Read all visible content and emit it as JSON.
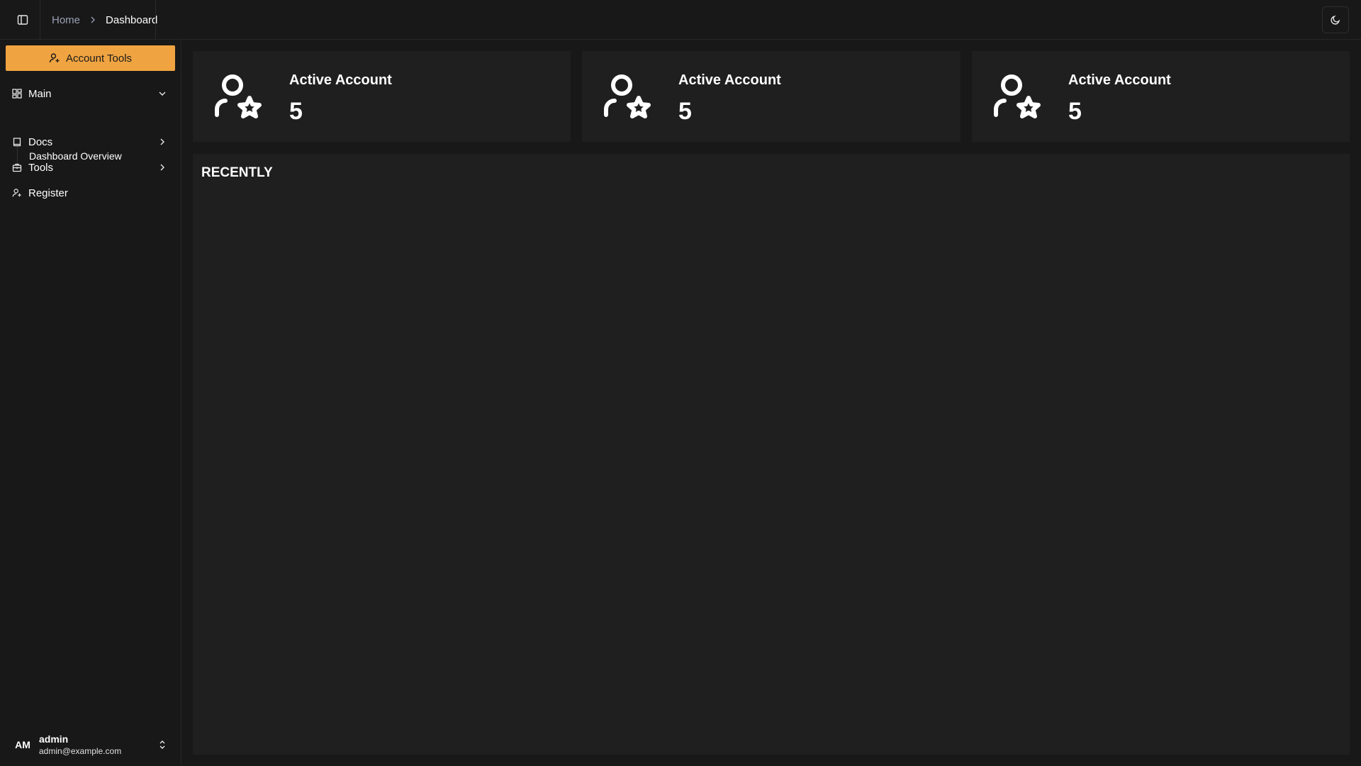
{
  "header": {
    "breadcrumb": {
      "home": "Home",
      "current": "Dashboard"
    },
    "icons": {
      "sidebar_toggle": "panel-left-icon",
      "theme_toggle": "moon-icon"
    }
  },
  "sidebar": {
    "primary_button": {
      "label": "Account Tools",
      "color": "#f0a441",
      "icon": "user-plus-icon"
    },
    "nav": {
      "main": {
        "label": "Main",
        "icon": "grid-icon",
        "expanded": true,
        "children": [
          {
            "label": "Dashboard Overview"
          }
        ]
      },
      "docs": {
        "label": "Docs",
        "icon": "book-icon",
        "expanded": false
      },
      "tools": {
        "label": "Tools",
        "icon": "toolbox-icon",
        "expanded": false
      },
      "register": {
        "label": "Register",
        "icon": "user-plus-icon"
      }
    },
    "user": {
      "initials": "AM",
      "name": "admin",
      "email": "admin@example.com"
    }
  },
  "main": {
    "cards": [
      {
        "label": "Active Account",
        "value": "5",
        "icon": "user-star-icon"
      },
      {
        "label": "Active Account",
        "value": "5",
        "icon": "user-star-icon"
      },
      {
        "label": "Active Account",
        "value": "5",
        "icon": "user-star-icon"
      }
    ],
    "panel": {
      "title": "RECENTLY"
    }
  }
}
